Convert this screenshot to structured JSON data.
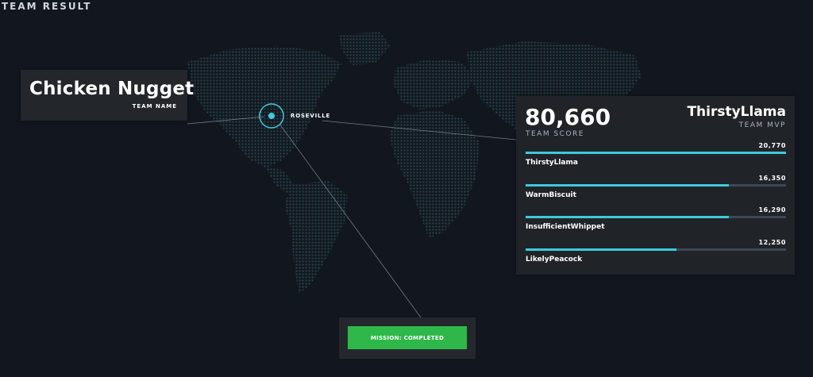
{
  "header": {
    "title": "TEAM RESULT"
  },
  "team": {
    "name": "Chicken Nugget",
    "name_label": "TEAM NAME"
  },
  "location": {
    "city": "ROSEVILLE"
  },
  "results": {
    "team_score": "80,660",
    "team_score_label": "TEAM SCORE",
    "mvp_name": "ThirstyLlama",
    "mvp_label": "TEAM MVP",
    "players": [
      {
        "name": "ThirstyLlama",
        "points": "20,770",
        "bar_fraction": 1.0
      },
      {
        "name": "WarmBiscuit",
        "points": "16,350",
        "bar_fraction": 0.78
      },
      {
        "name": "InsufficientWhippet",
        "points": "16,290",
        "bar_fraction": 0.78
      },
      {
        "name": "LikelyPeacock",
        "points": "12,250",
        "bar_fraction": 0.58
      }
    ]
  },
  "mission": {
    "status_label": "MISSION: COMPLETED"
  },
  "colors": {
    "background": "#12171f",
    "map_dots": "#2c4a52",
    "accent": "#3fc9dc",
    "bar_track": "#3e4852",
    "success": "#2fb84a"
  }
}
